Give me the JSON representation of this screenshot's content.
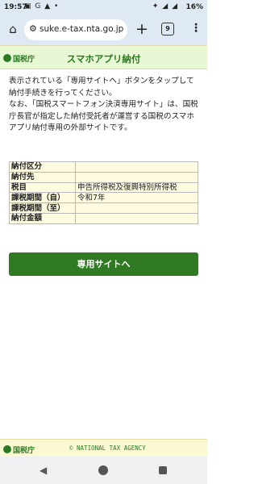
{
  "statusbar": {
    "time": "19:57",
    "battery": "16%"
  },
  "browser": {
    "url": "suke.e-tax.nta.go.jp",
    "tab_count": "9"
  },
  "header": {
    "logo": "国税庁",
    "title": "スマホアプリ納付"
  },
  "intro": {
    "line1": "表示されている「専用サイトへ」ボタンをタップして納付手続きを行ってください。",
    "line2": "なお、「国税スマートフォン決済専用サイト」は、国税庁長官が指定した納付受託者が運営する国税のスマホアプリ納付専用の外部サイトです。"
  },
  "table": {
    "rows": [
      {
        "label": "納付区分",
        "value": ""
      },
      {
        "label": "納付先",
        "value": ""
      },
      {
        "label": "税目",
        "value": "申告所得税及復興特別所得税"
      },
      {
        "label": "課税期間（自）",
        "value": "令和7年"
      },
      {
        "label": "課税期間（至）",
        "value": ""
      },
      {
        "label": "納付金額",
        "value": ""
      }
    ]
  },
  "button": {
    "label": "専用サイトへ"
  },
  "footer": {
    "logo": "国税庁",
    "copyright": "© NATIONAL TAX AGENCY"
  }
}
